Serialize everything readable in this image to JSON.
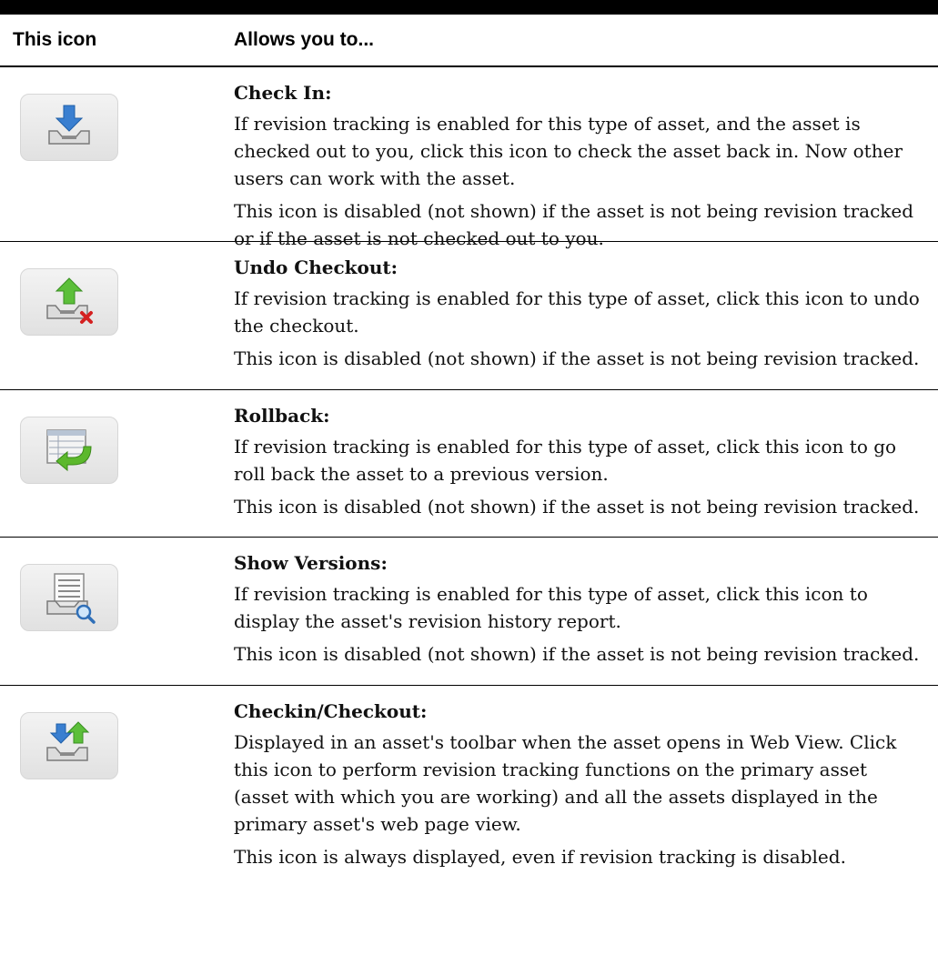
{
  "header": {
    "col_icon": "This icon",
    "col_desc": "Allows you to..."
  },
  "rows": [
    {
      "icon": "check-in-icon",
      "title": "Check In:",
      "paragraphs": [
        "If revision tracking is enabled for this type of asset, and the asset is checked out to you, click this icon to check the asset back in. Now other users can work with the asset.",
        "This icon is disabled (not shown) if the asset is not being revision tracked or if the asset is not checked out to you."
      ]
    },
    {
      "icon": "undo-checkout-icon",
      "title": "Undo Checkout:",
      "paragraphs": [
        "If revision tracking is enabled for this type of asset, click this icon to undo the checkout.",
        "This icon is disabled (not shown) if the asset is not being revision tracked."
      ]
    },
    {
      "icon": "rollback-icon",
      "title": "Rollback:",
      "paragraphs": [
        "If revision tracking is enabled for this type of asset, click this icon to go roll back the asset to a previous version.",
        "This icon is disabled (not shown) if the asset is not being revision tracked."
      ]
    },
    {
      "icon": "show-versions-icon",
      "title": "Show Versions:",
      "paragraphs": [
        "If revision tracking is enabled for this type of asset, click this icon to display the asset's revision history report.",
        "This icon is disabled (not shown) if the asset is not being revision tracked."
      ]
    },
    {
      "icon": "checkin-checkout-icon",
      "title": "Checkin/Checkout:",
      "paragraphs": [
        "Displayed in an asset's toolbar when the asset opens in Web View. Click this icon to perform revision tracking functions on the primary asset (asset with which you are working) and all the assets displayed in the primary asset's web page view.",
        "This icon is always displayed, even if revision tracking is disabled."
      ]
    }
  ]
}
